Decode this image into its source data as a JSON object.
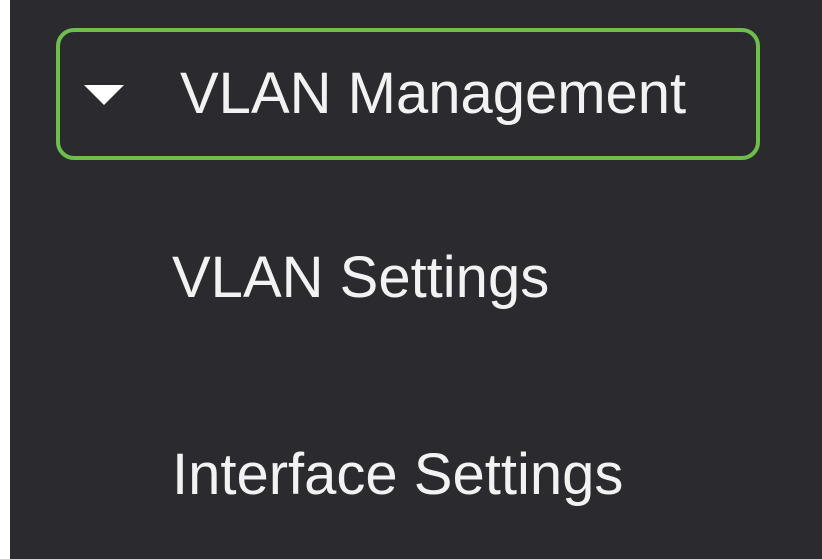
{
  "menu": {
    "parent": {
      "label": "VLAN Management",
      "expanded": true,
      "icon": "caret-down-icon",
      "highlight_color": "#6cc04a"
    },
    "children": [
      {
        "label": "VLAN Settings"
      },
      {
        "label": "Interface Settings"
      }
    ]
  },
  "theme": {
    "background": "#2b2a2f",
    "text": "#f2f2f2"
  }
}
